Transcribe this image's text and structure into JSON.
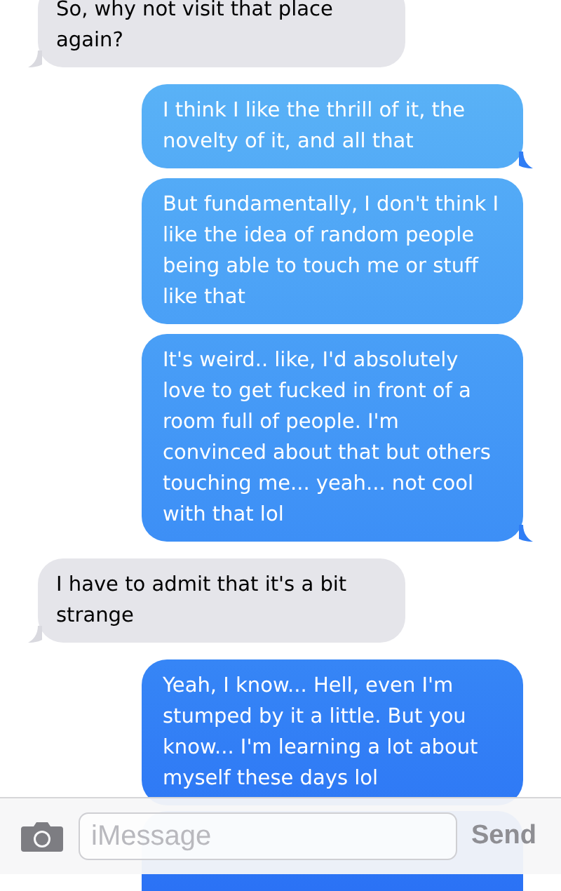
{
  "messages": [
    {
      "kind": "received",
      "text": "So, why not visit that place again?",
      "tail": true
    },
    {
      "kind": "sent",
      "text": "I think I like the thrill of it, the novelty of it, and all that",
      "tail": true
    },
    {
      "kind": "sent",
      "text": "But fundamentally, I don't think I like the idea of random people being able to touch me or stuff like that",
      "tail": false
    },
    {
      "kind": "sent",
      "text": "It's weird.. like, I'd absolutely love to get fucked in front of a room full of people. I'm convinced about that but others touching me... yeah... not cool with that lol",
      "tail": true
    },
    {
      "kind": "received",
      "text": "I have to admit that it's a bit strange",
      "tail": true
    },
    {
      "kind": "sent",
      "text": "Yeah, I know... Hell, even I'm stumped by it a little. But you know... I'm learning a lot about myself these days lol",
      "tail": false
    }
  ],
  "composer": {
    "placeholder": "iMessage",
    "send": "Send"
  }
}
